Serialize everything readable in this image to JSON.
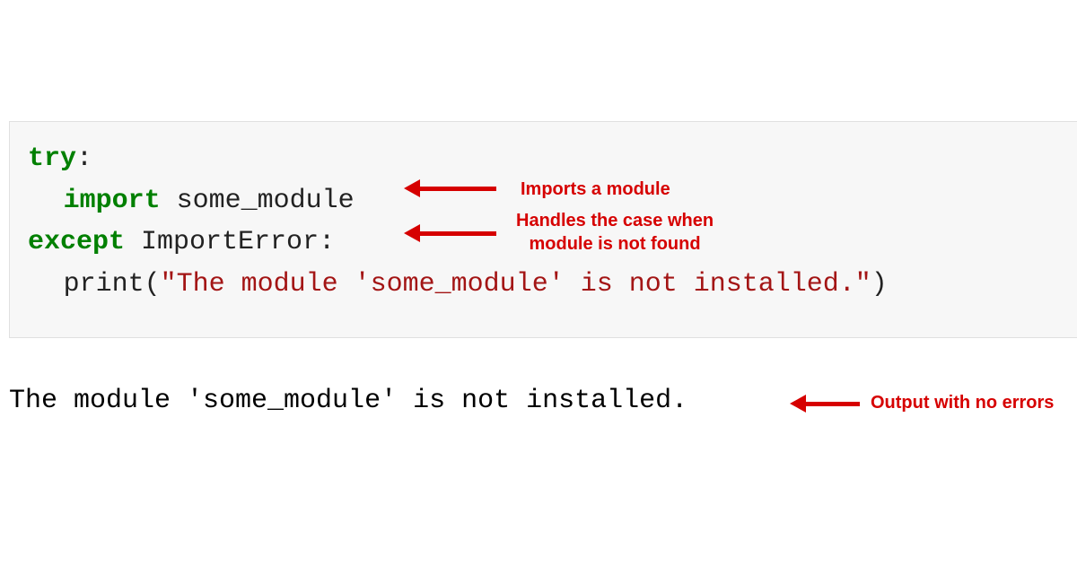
{
  "code": {
    "line1": {
      "try": "try",
      "colon": ":"
    },
    "line2": {
      "import": "import",
      "module": " some_module"
    },
    "line3": {
      "except": "except",
      "exc": " ImportError",
      "colon": ":"
    },
    "line4": {
      "func": "print",
      "lparen": "(",
      "str": "\"The module 'some_module' is not installed.\"",
      "rparen": ")"
    }
  },
  "output": "The module 'some_module' is not installed.",
  "annotations": {
    "a1": "Imports a module",
    "a2_l1": "Handles the case when",
    "a2_l2": "module is not found",
    "a3": "Output with no errors"
  }
}
